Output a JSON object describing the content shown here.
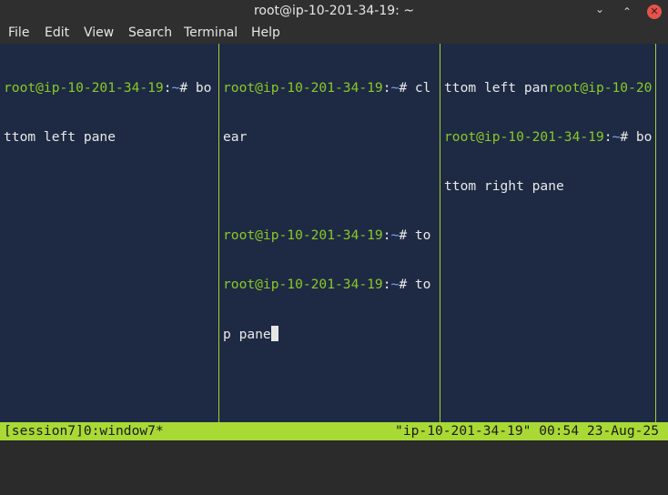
{
  "window": {
    "title": "root@ip-10-201-34-19: ~"
  },
  "window_controls": {
    "minimize": "⌄",
    "maximize": "⌃",
    "close": "✕"
  },
  "menu": [
    "File",
    "Edit",
    "View",
    "Search",
    "Terminal",
    "Help"
  ],
  "colors": {
    "prompt": "#8ac926",
    "path": "#7da6ff",
    "text": "#e8e8e8",
    "background": "#1e2a44",
    "status_bar": "#a9d934"
  },
  "panes": {
    "left": {
      "lines": [
        {
          "host": "root@ip-10-201-34-19",
          "sep": ":",
          "path": "~",
          "rest": "# bo"
        },
        {
          "text": "ttom left pane"
        }
      ]
    },
    "middle": {
      "lines": [
        {
          "host": "root@ip-10-201-34-19",
          "sep": ":",
          "path": "~",
          "rest": "# cl"
        },
        {
          "text": "ear"
        },
        {
          "text": ""
        },
        {
          "host": "root@ip-10-201-34-19",
          "sep": ":",
          "path": "~",
          "rest": "# to"
        },
        {
          "host": "root@ip-10-201-34-19",
          "sep": ":",
          "path": "~",
          "rest": "# to"
        },
        {
          "text": "p pane"
        }
      ]
    },
    "right": {
      "lines": [
        {
          "pre": "ttom left pan",
          "host": "root@ip-10-20"
        },
        {
          "host": "root@ip-10-201-34-19",
          "sep": ":",
          "path": "~",
          "rest": "# bo"
        },
        {
          "text": "ttom right pane"
        }
      ]
    }
  },
  "status_bar": {
    "left": "[session7]0:window7*",
    "right": "\"ip-10-201-34-19\" 00:54 23-Aug-25"
  }
}
